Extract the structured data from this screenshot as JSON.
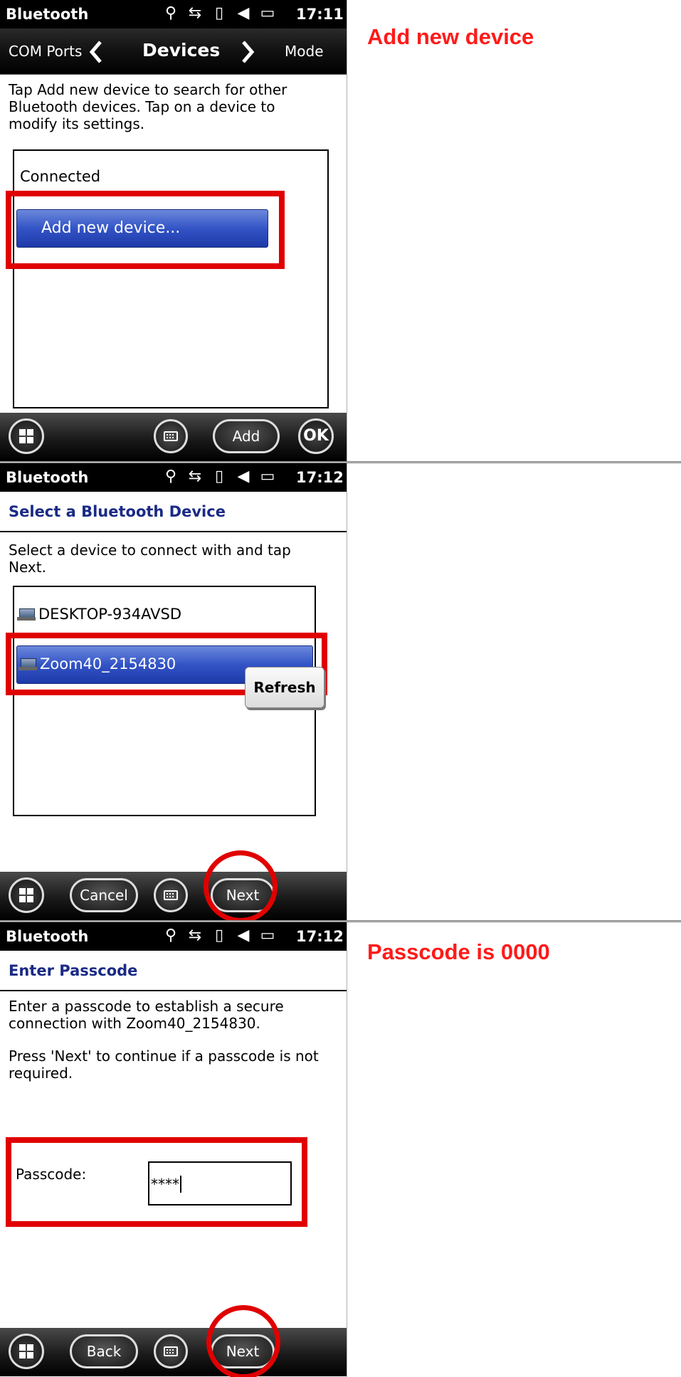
{
  "screen1": {
    "status": {
      "title": "Bluetooth",
      "time": "17:11"
    },
    "nav": {
      "left": "COM Ports",
      "center": "Devices",
      "right": "Mode"
    },
    "instructions_line1": "Tap Add new device to search for other",
    "instructions_line2": "Bluetooth devices. Tap on a device to",
    "instructions_line3": "modify its settings.",
    "section_label": "Connected",
    "add_device_label": "Add new device...",
    "softkeys": {
      "add": "Add",
      "ok": "OK"
    },
    "annotation": "Add new device"
  },
  "screen2": {
    "status": {
      "title": "Bluetooth",
      "time": "17:12"
    },
    "header": "Select a Bluetooth Device",
    "instructions_line1": "Select a device to connect with and tap",
    "instructions_line2": "Next.",
    "devices": [
      "DESKTOP-934AVSD",
      "Zoom40_2154830"
    ],
    "refresh": "Refresh",
    "softkeys": {
      "cancel": "Cancel",
      "next": "Next"
    }
  },
  "screen3": {
    "status": {
      "title": "Bluetooth",
      "time": "17:12"
    },
    "header": "Enter Passcode",
    "instructions_line1": "Enter a passcode to establish a secure",
    "instructions_line2": "connection with Zoom40_2154830.",
    "instructions_line3": "Press 'Next' to continue if a passcode is not",
    "instructions_line4": "required.",
    "passcode_label": "Passcode:",
    "passcode_value": "****",
    "softkeys": {
      "back": "Back",
      "next": "Next"
    },
    "annotation": "Passcode is 0000"
  },
  "colors": {
    "annotation_red": "#ff1a1a",
    "header_blue": "#1a2a86",
    "selection_blue": "#3354c6"
  },
  "status_icons": [
    "antenna-icon",
    "sync-arrows-icon",
    "no-signal-icon",
    "speaker-icon",
    "battery-icon"
  ]
}
